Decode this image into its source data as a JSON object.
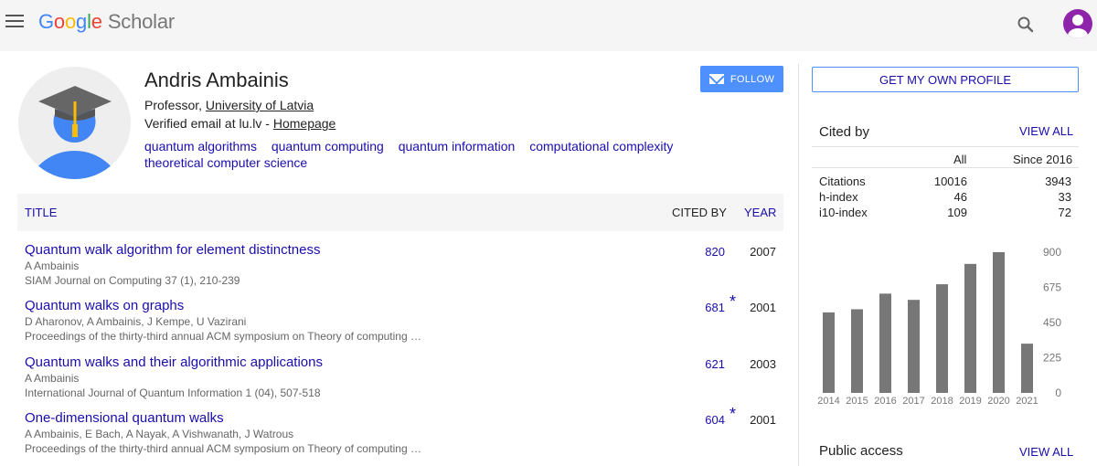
{
  "header": {
    "logo_letters": [
      "G",
      "o",
      "o",
      "g",
      "l",
      "e"
    ],
    "logo_suffix": "Scholar"
  },
  "profile": {
    "name": "Andris Ambainis",
    "role": "Professor, ",
    "university": "University of Latvia",
    "verified_prefix": "Verified email at lu.lv - ",
    "homepage": "Homepage",
    "interests": [
      "quantum algorithms",
      "quantum computing",
      "quantum information",
      "computational complexity",
      "theoretical computer science"
    ],
    "follow_label": "FOLLOW"
  },
  "table": {
    "col_title": "TITLE",
    "col_cited": "CITED BY",
    "col_year": "YEAR",
    "articles": [
      {
        "title": "Quantum walk algorithm for element distinctness",
        "authors": "A Ambainis",
        "venue": "SIAM Journal on Computing 37 (1), 210-239",
        "cited": "820",
        "star": "",
        "year": "2007"
      },
      {
        "title": "Quantum walks on graphs",
        "authors": "D Aharonov, A Ambainis, J Kempe, U Vazirani",
        "venue": "Proceedings of the thirty-third annual ACM symposium on Theory of computing …",
        "cited": "681",
        "star": "*",
        "year": "2001"
      },
      {
        "title": "Quantum walks and their algorithmic applications",
        "authors": "A Ambainis",
        "venue": "International Journal of Quantum Information 1 (04), 507-518",
        "cited": "621",
        "star": "",
        "year": "2003"
      },
      {
        "title": "One-dimensional quantum walks",
        "authors": "A Ambainis, E Bach, A Nayak, A Vishwanath, J Watrous",
        "venue": "Proceedings of the thirty-third annual ACM symposium on Theory of computing …",
        "cited": "604",
        "star": "*",
        "year": "2001"
      }
    ]
  },
  "sidebar": {
    "get_profile": "GET MY OWN PROFILE",
    "cited_by_title": "Cited by",
    "view_all": "VIEW ALL",
    "col_all": "All",
    "col_since": "Since 2016",
    "stats": [
      {
        "label": "Citations",
        "all": "10016",
        "since": "3943"
      },
      {
        "label": "h-index",
        "all": "46",
        "since": "33"
      },
      {
        "label": "i10-index",
        "all": "109",
        "since": "72"
      }
    ],
    "public_access_title": "Public access",
    "public_access_view_all": "VIEW ALL"
  },
  "chart_data": {
    "type": "bar",
    "categories": [
      "2014",
      "2015",
      "2016",
      "2017",
      "2018",
      "2019",
      "2020",
      "2021"
    ],
    "values": [
      515,
      535,
      635,
      595,
      695,
      825,
      900,
      315
    ],
    "ylim": [
      0,
      900
    ],
    "yticks": [
      0,
      225,
      450,
      675,
      900
    ],
    "bar_color": "#777777",
    "title": "",
    "xlabel": "",
    "ylabel": ""
  }
}
